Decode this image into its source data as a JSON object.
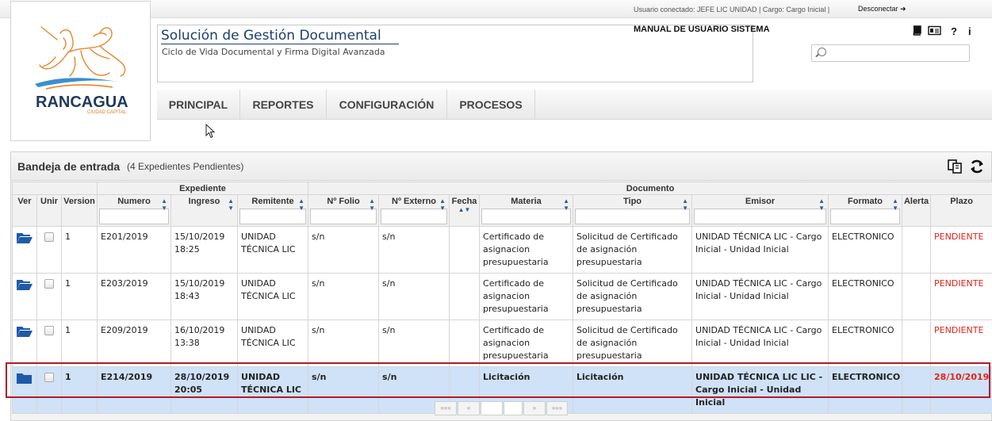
{
  "topbar": {
    "user_line": "Usuario conectado: JEFE LIC UNIDAD | Cargo: Cargo Inicial |",
    "logout_label": "Desconectar"
  },
  "logo": {
    "name": "RANCAGUA",
    "tagline": "CIUDAD CAPITAL",
    "colors": {
      "horse": "#e8862a",
      "word": "#1f3a5c",
      "wave": "#3a8fd0"
    }
  },
  "header": {
    "title": "Solución de Gestión Documental",
    "subtitle": "Ciclo de Vida Documental y Firma Digital Avanzada",
    "manual": "MANUAL DE USUARIO SISTEMA",
    "help_label": "?",
    "info_label": "i",
    "icons": [
      "book-icon",
      "id-card-icon",
      "help-icon",
      "info-icon"
    ]
  },
  "search": {
    "placeholder": "",
    "value": ""
  },
  "menu": [
    {
      "label": "PRINCIPAL"
    },
    {
      "label": "REPORTES"
    },
    {
      "label": "CONFIGURACIÓN"
    },
    {
      "label": "PROCESOS"
    }
  ],
  "inbox": {
    "title": "Bandeja de entrada",
    "count": "(4 Expedientes Pendientes)",
    "group_expediente": "Expediente",
    "group_documento": "Documento",
    "columns": {
      "ver": "Ver",
      "unir": "Unir",
      "version": "Version",
      "numero": "Numero",
      "ingreso": "Ingreso",
      "remitente": "Remitente",
      "folio": "Nº Folio",
      "externo": "Nº Externo",
      "fecha": "Fecha",
      "materia": "Materia",
      "tipo": "Tipo",
      "emisor": "Emisor",
      "formato": "Formato",
      "alerta": "Alerta",
      "plazo": "Plazo"
    },
    "rows": [
      {
        "version": "1",
        "numero": "E201/2019",
        "ingreso_date": "15/10/2019",
        "ingreso_time": "18:25",
        "remitente": "UNIDAD TÉCNICA LIC",
        "folio": "s/n",
        "externo": "s/n",
        "fecha": "",
        "materia": "Certificado de asignacion presupuestaria",
        "tipo": "Solicitud de Certificado de asignación presupuestaria",
        "emisor": "UNIDAD TÉCNICA LIC - Cargo Inicial - Unidad Inicial",
        "formato": "ELECTRONICO",
        "alerta": "",
        "plazo": "PENDIENTE",
        "selected": false
      },
      {
        "version": "1",
        "numero": "E203/2019",
        "ingreso_date": "15/10/2019",
        "ingreso_time": "18:43",
        "remitente": "UNIDAD TÉCNICA LIC",
        "folio": "s/n",
        "externo": "s/n",
        "fecha": "",
        "materia": "Certificado de asignacion presupuestaria",
        "tipo": "Solicitud de Certificado de asignación presupuestaria",
        "emisor": "UNIDAD TÉCNICA LIC - Cargo Inicial - Unidad Inicial",
        "formato": "ELECTRONICO",
        "alerta": "",
        "plazo": "PENDIENTE",
        "selected": false
      },
      {
        "version": "1",
        "numero": "E209/2019",
        "ingreso_date": "16/10/2019",
        "ingreso_time": "13:38",
        "remitente": "UNIDAD TÉCNICA LIC",
        "folio": "s/n",
        "externo": "s/n",
        "fecha": "",
        "materia": "Certificado de asignacion presupuestaria",
        "tipo": "Solicitud de Certificado de asignación presupuestaria",
        "emisor": "UNIDAD TÉCNICA LIC - Cargo Inicial - Unidad Inicial",
        "formato": "ELECTRONICO",
        "alerta": "",
        "plazo": "PENDIENTE",
        "selected": false
      },
      {
        "version": "1",
        "numero": "E214/2019",
        "ingreso_date": "28/10/2019",
        "ingreso_time": "20:05",
        "remitente": "UNIDAD TÉCNICA LIC",
        "folio": "s/n",
        "externo": "s/n",
        "fecha": "",
        "materia": "Licitación",
        "tipo": "Licitación",
        "emisor": "UNIDAD TÉCNICA LIC LIC - Cargo Inicial - Unidad Inicial",
        "formato": "ELECTRONICO",
        "alerta": "",
        "plazo": "28/10/2019",
        "selected": true
      }
    ]
  },
  "pager": {
    "first": "«««",
    "prev": "«",
    "next": "»",
    "last": "»»»"
  },
  "colors": {
    "pending": "#e2231a",
    "selected_row": "#cfe2f7",
    "selected_outline": "#b01a2a",
    "folder": "#1e5aa8",
    "title": "#1d3d6b"
  }
}
